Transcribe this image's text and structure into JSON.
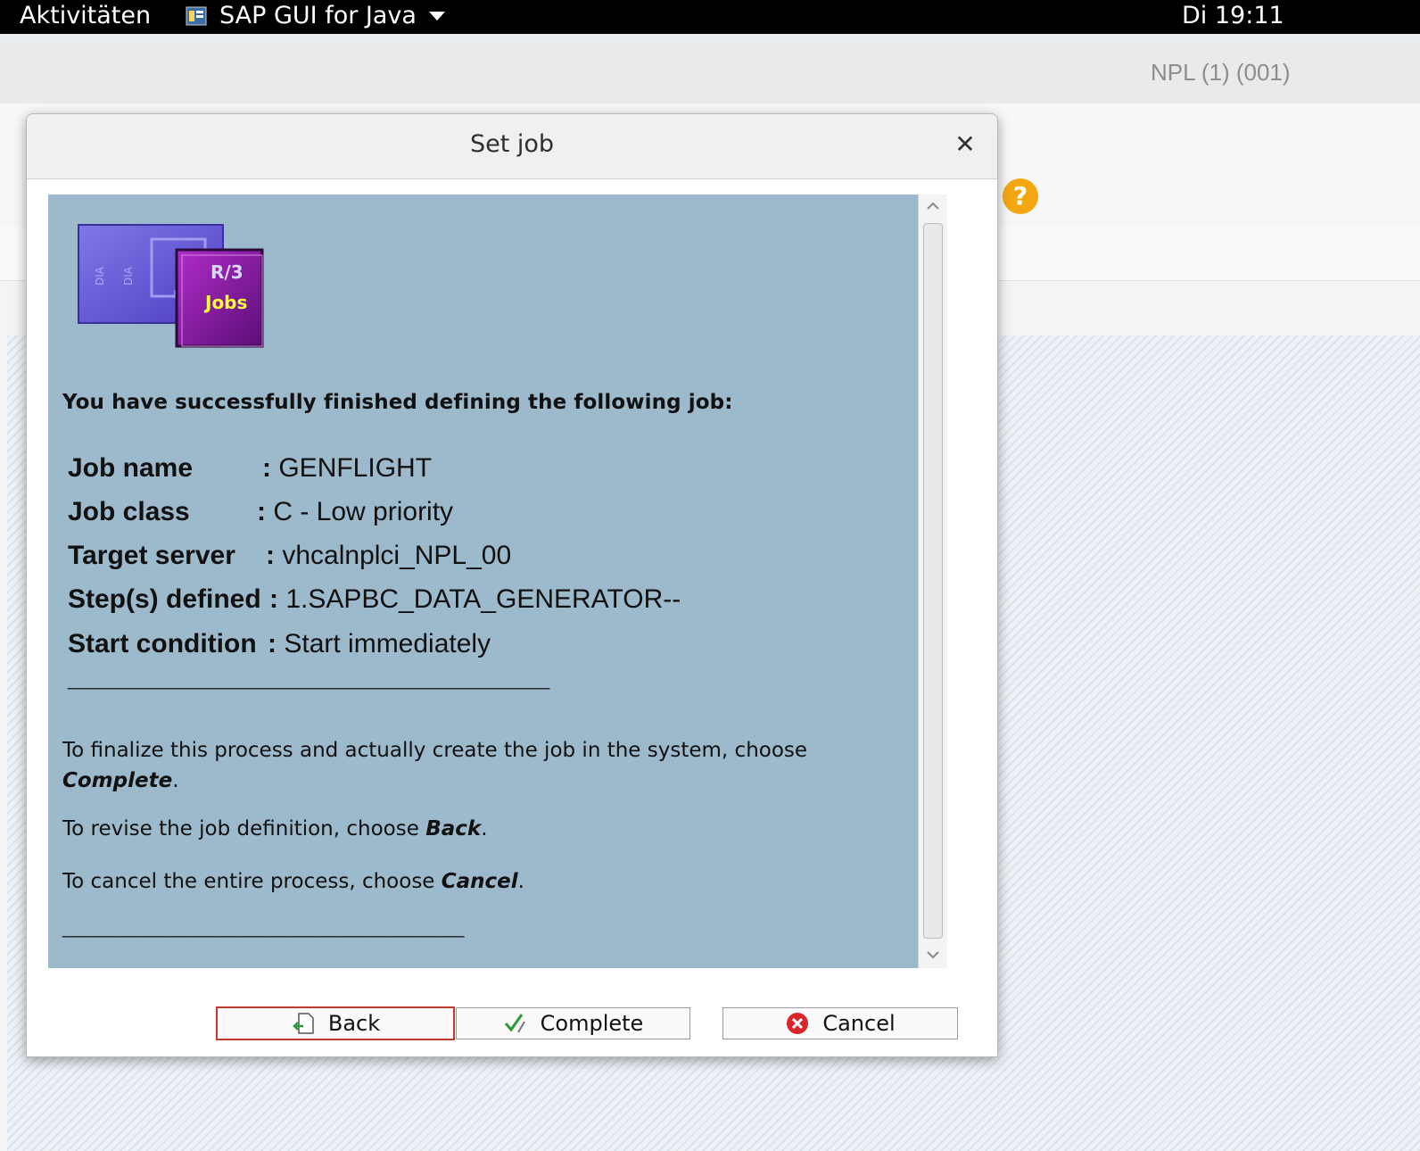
{
  "topbar": {
    "activities": "Aktivitäten",
    "app_name": "SAP GUI for Java",
    "clock": "Di 19:11"
  },
  "sap_window": {
    "system_label": "NPL (1) (001)"
  },
  "dialog": {
    "title": "Set job",
    "intro": "You have successfully finished defining the following job:",
    "logo_text_top": "R/3",
    "logo_text_bottom": "Jobs",
    "fields": [
      {
        "label": "Job name",
        "sep": ":",
        "value": "GENFLIGHT"
      },
      {
        "label": "Job class",
        "sep": ":",
        "value": "C - Low priority"
      },
      {
        "label": "Target server",
        "sep": ":",
        "value": "vhcalnplci_NPL_00"
      },
      {
        "label": "Step(s) defined",
        "sep": ":",
        "value": "1.SAPBC_DATA_GENERATOR--"
      },
      {
        "label": "Start condition",
        "sep": ":",
        "value": "Start immediately"
      }
    ],
    "rule1": "________________________________________________",
    "para1_text": "To finalize this process and actually create the job in the system, choose",
    "para1_emph": "Complete",
    "para1_end": ".",
    "para2_text": "To revise the job definition, choose ",
    "para2_emph": "Back",
    "para2_end": ".",
    "para3_text": "To cancel the entire process, choose ",
    "para3_emph": "Cancel",
    "para3_end": ".",
    "rule2": "________________________________________",
    "buttons": {
      "back": "Back",
      "complete": "Complete",
      "cancel": "Cancel"
    }
  },
  "colors": {
    "panel_bg": "#9db9cc",
    "help_icon": "#f3a712",
    "cancel_icon": "#d9262b",
    "complete_icon": "#2e9a3a"
  }
}
